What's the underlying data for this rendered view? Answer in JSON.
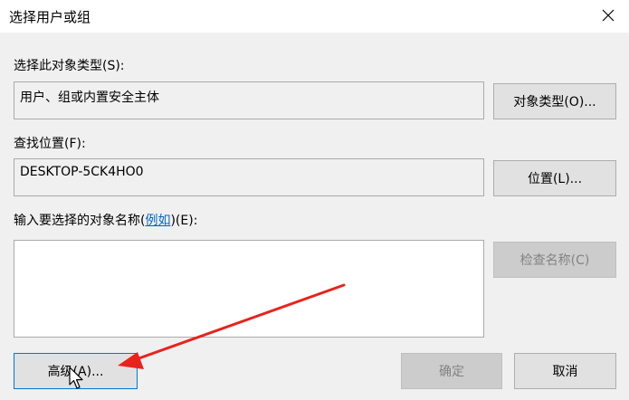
{
  "window": {
    "title": "选择用户或组"
  },
  "object_type": {
    "label": "选择此对象类型(S):",
    "value": "用户、组或内置安全主体",
    "button": "对象类型(O)..."
  },
  "location": {
    "label": "查找位置(F):",
    "value": "DESKTOP-5CK4HO0",
    "button": "位置(L)..."
  },
  "names": {
    "label_prefix": "输入要选择的对象名称(",
    "label_link": "例如",
    "label_suffix": ")(E):",
    "value": "",
    "check_button": "检查名称(C)"
  },
  "footer": {
    "advanced_button": "高级(A)...",
    "ok_button": "确定",
    "cancel_button": "取消"
  },
  "colors": {
    "annotation_arrow": "#e8231c",
    "link": "#0066cc"
  },
  "icons": [
    "close-icon",
    "mouse-cursor-icon",
    "annotation-arrow"
  ]
}
